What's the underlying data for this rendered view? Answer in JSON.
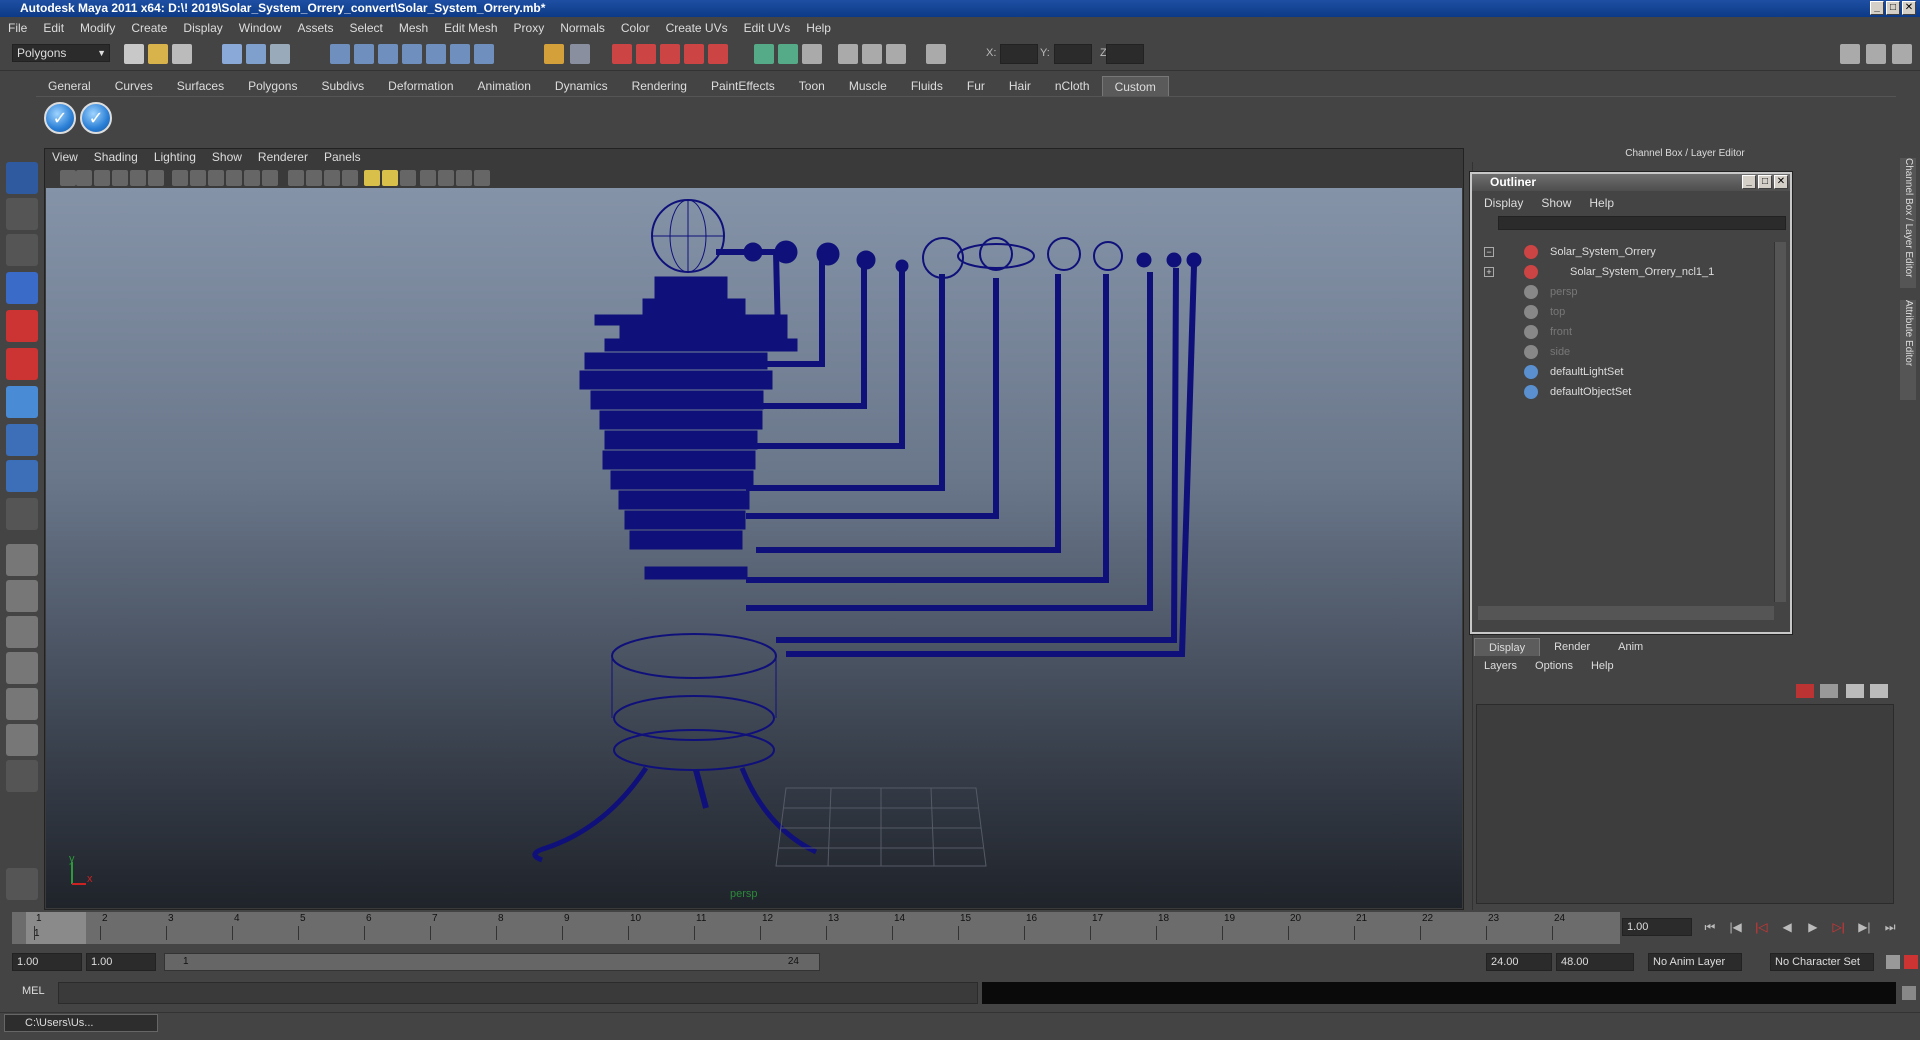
{
  "window": {
    "title": "Autodesk Maya 2011 x64: D:\\! 2019\\Solar_System_Orrery_convert\\Solar_System_Orrery.mb*"
  },
  "menubar": [
    "File",
    "Edit",
    "Modify",
    "Create",
    "Display",
    "Window",
    "Assets",
    "Select",
    "Mesh",
    "Edit Mesh",
    "Proxy",
    "Normals",
    "Color",
    "Create UVs",
    "Edit UVs",
    "Help"
  ],
  "status": {
    "mode": "Polygons",
    "x_label": "X:",
    "y_label": "Y:",
    "z_label": "Z:"
  },
  "shelf": {
    "tabs": [
      "General",
      "Curves",
      "Surfaces",
      "Polygons",
      "Subdivs",
      "Deformation",
      "Animation",
      "Dynamics",
      "Rendering",
      "PaintEffects",
      "Toon",
      "Muscle",
      "Fluids",
      "Fur",
      "Hair",
      "nCloth",
      "Custom"
    ],
    "active_tab": "Custom"
  },
  "viewport": {
    "menu": [
      "View",
      "Shading",
      "Lighting",
      "Show",
      "Renderer",
      "Panels"
    ],
    "camera_label": "persp",
    "axis_y": "y",
    "axis_x": "x"
  },
  "channel_box": {
    "title": "Channel Box / Layer Editor",
    "side_tab1": "Channel Box / Layer Editor",
    "side_tab2": "Attribute Editor"
  },
  "outliner": {
    "title": "Outliner",
    "menu": [
      "Display",
      "Show",
      "Help"
    ],
    "items": [
      {
        "label": "Solar_System_Orrery",
        "icon": "transform-icon",
        "dim": false
      },
      {
        "label": "Solar_System_Orrery_ncl1_1",
        "icon": "transform-icon",
        "dim": false
      },
      {
        "label": "persp",
        "icon": "camera-icon",
        "dim": true
      },
      {
        "label": "top",
        "icon": "camera-icon",
        "dim": true
      },
      {
        "label": "front",
        "icon": "camera-icon",
        "dim": true
      },
      {
        "label": "side",
        "icon": "camera-icon",
        "dim": true
      },
      {
        "label": "defaultLightSet",
        "icon": "set-icon",
        "dim": false
      },
      {
        "label": "defaultObjectSet",
        "icon": "set-icon",
        "dim": false
      }
    ]
  },
  "layer_editor": {
    "tabs": [
      "Display",
      "Render",
      "Anim"
    ],
    "active_tab": "Display",
    "menu": [
      "Layers",
      "Options",
      "Help"
    ]
  },
  "timeline": {
    "ticks": [
      "1",
      "2",
      "3",
      "4",
      "5",
      "6",
      "7",
      "8",
      "9",
      "10",
      "11",
      "12",
      "13",
      "14",
      "15",
      "16",
      "17",
      "18",
      "19",
      "20",
      "21",
      "22",
      "23",
      "24"
    ],
    "current_frame": "1.00",
    "current_marker": "1"
  },
  "range": {
    "start": "1.00",
    "playback_start": "1.00",
    "slider_start": "1",
    "slider_end": "24",
    "playback_end": "24.00",
    "end": "48.00",
    "anim_layer": "No Anim Layer",
    "character_set": "No Character Set"
  },
  "command": {
    "label": "MEL"
  },
  "taskbar": {
    "item": "C:\\Users\\Us..."
  }
}
